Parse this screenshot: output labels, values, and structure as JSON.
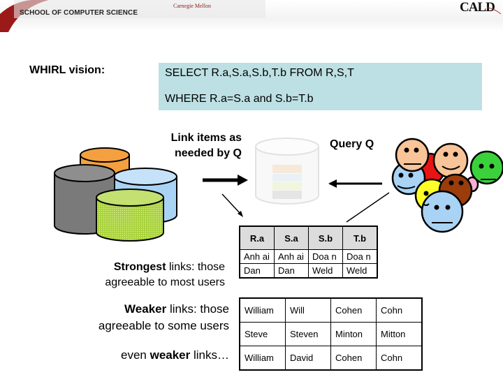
{
  "header": {
    "university": "Carnegie Mellon",
    "school": "SCHOOL OF COMPUTER SCIENCE",
    "logo": "CALD"
  },
  "title": "WHIRL vision:",
  "query": {
    "line1": "SELECT R.a,S.a,S.b,T.b FROM R,S,T",
    "line2": "WHERE R.a=S.a and S.b=T.b",
    "bg_color": "#bde0e4"
  },
  "labels": {
    "link_items_line1": "Link items as",
    "link_items_line2": "needed by Q",
    "query_q": "Query Q"
  },
  "databases": [
    {
      "name": "orange-db",
      "color": "#f5a040"
    },
    {
      "name": "gray-db",
      "color": "#7a7a7a"
    },
    {
      "name": "blue-db",
      "color": "#a9d3f5"
    },
    {
      "name": "green-db",
      "color": "#a8d23c"
    }
  ],
  "users": [
    {
      "color": "#f8c498",
      "mood": "neutral"
    },
    {
      "color": "#e81414",
      "mood": "hidden"
    },
    {
      "color": "#f8c498",
      "mood": "happy"
    },
    {
      "color": "#3ad23a",
      "mood": "neutral"
    },
    {
      "color": "#a9d3f5",
      "mood": "happy"
    },
    {
      "color": "#ffff28",
      "mood": "happy"
    },
    {
      "color": "#9a3d0a",
      "mood": "happy"
    },
    {
      "color": "#a9d3f5",
      "mood": "neutral"
    }
  ],
  "strengths": {
    "strongest_bold": "Strongest",
    "strongest_rest": " links: those",
    "strongest_line2": "agreeable to most users",
    "weaker_bold": "Weaker",
    "weaker_rest": " links: those",
    "weaker_line2": "agreeable to some users",
    "weakest_pre": "even ",
    "weakest_bold": "weaker",
    "weakest_rest": " links…"
  },
  "result_table": {
    "headers": [
      "R.a",
      "S.a",
      "S.b",
      "T.b"
    ],
    "rows": [
      [
        "Anh ai",
        "Anh ai",
        "Doa n",
        "Doa n"
      ],
      [
        "Dan",
        "Dan",
        "Weld",
        "Weld"
      ]
    ]
  },
  "weaker_table": {
    "rows": [
      [
        "William",
        "Will",
        "Cohen",
        "Cohn"
      ],
      [
        "Steve",
        "Steven",
        "Minton",
        "Mitton"
      ],
      [
        "William",
        "David",
        "Cohen",
        "Cohn"
      ]
    ]
  }
}
